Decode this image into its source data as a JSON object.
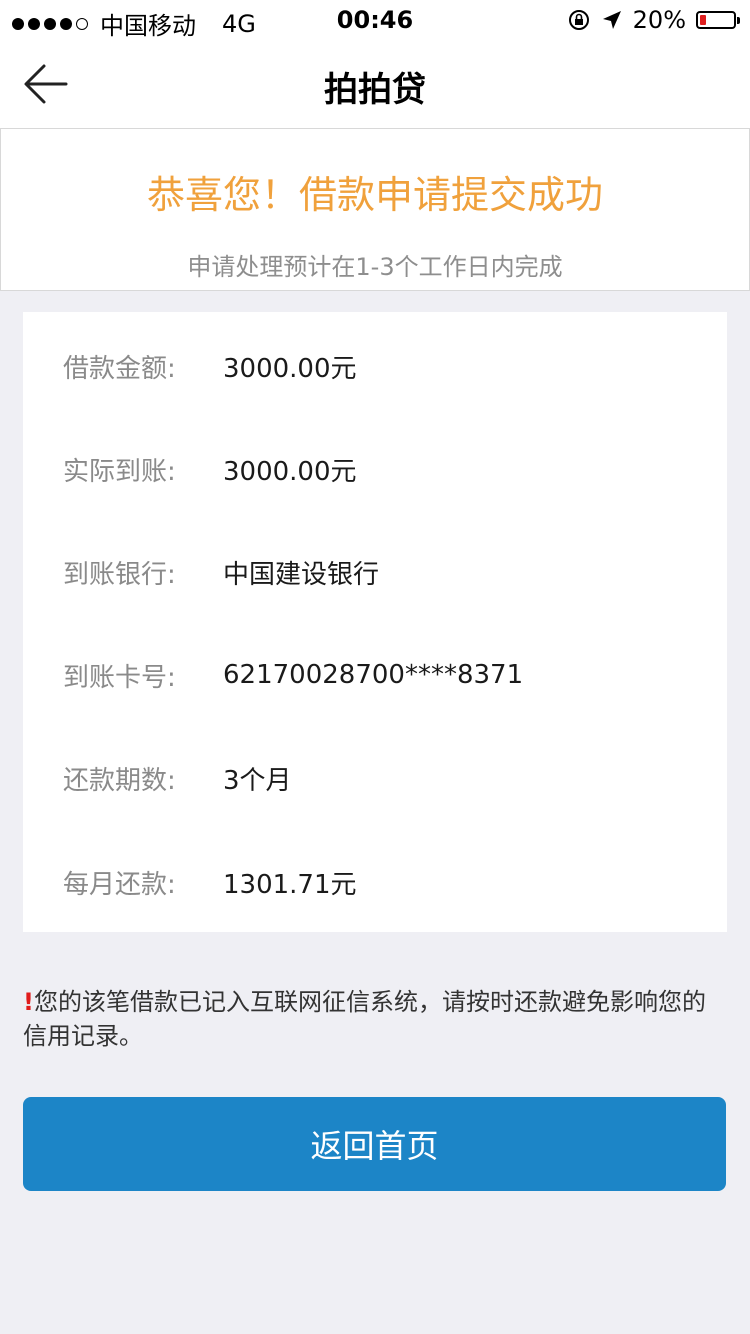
{
  "status_bar": {
    "carrier": "中国移动",
    "network": "4G",
    "time": "00:46",
    "battery_text": "20%",
    "battery_level": 0.2,
    "signal_bars_filled": 4,
    "signal_bars_total": 5
  },
  "nav": {
    "title": "拍拍贷",
    "back_icon": "back-arrow-icon"
  },
  "success": {
    "title": "恭喜您！借款申请提交成功",
    "subtitle": "申请处理预计在1-3个工作日内完成",
    "title_color": "#f0a13c"
  },
  "details": [
    {
      "label": "借款金额:",
      "value": "3000.00元"
    },
    {
      "label": "实际到账:",
      "value": "3000.00元"
    },
    {
      "label": "到账银行:",
      "value": "中国建设银行"
    },
    {
      "label": "到账卡号:",
      "value": "62170028700****8371"
    },
    {
      "label": "还款期数:",
      "value": "3个月"
    },
    {
      "label": "每月还款:",
      "value": "1301.71元"
    }
  ],
  "notice": {
    "mark": "!",
    "text": "您的该笔借款已记入互联网征信系统，请按时还款避免影响您的信用记录。"
  },
  "button": {
    "label": "返回首页",
    "color": "#1c85c7"
  }
}
